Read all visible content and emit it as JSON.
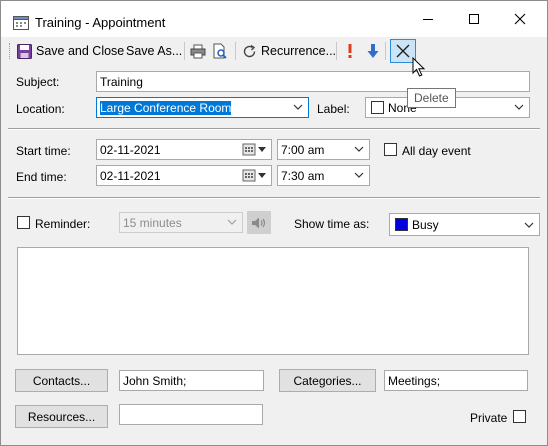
{
  "window": {
    "title": "Training - Appointment"
  },
  "toolbar": {
    "save_close_label": "Save and Close",
    "save_as_label": "Save As...",
    "recurrence_label": "Recurrence...",
    "tooltip": "Delete"
  },
  "form": {
    "subject_label": "Subject:",
    "subject_value": "Training",
    "location_label": "Location:",
    "location_value": "Large Conference Room",
    "label_label": "Label:",
    "label_value": "None",
    "start_label": "Start time:",
    "start_date": "02-11-2021",
    "start_time": "7:00 am",
    "end_label": "End time:",
    "end_date": "02-11-2021",
    "end_time": "7:30 am",
    "all_day_label": "All day event",
    "reminder_label": "Reminder:",
    "reminder_value": "15 minutes",
    "show_time_label": "Show time as:",
    "show_time_value": "Busy",
    "busy_color": "#0000e0",
    "contacts_label": "Contacts...",
    "contacts_value": "John Smith;",
    "categories_label": "Categories...",
    "categories_value": "Meetings;",
    "resources_label": "Resources...",
    "resources_value": "",
    "private_label": "Private"
  }
}
